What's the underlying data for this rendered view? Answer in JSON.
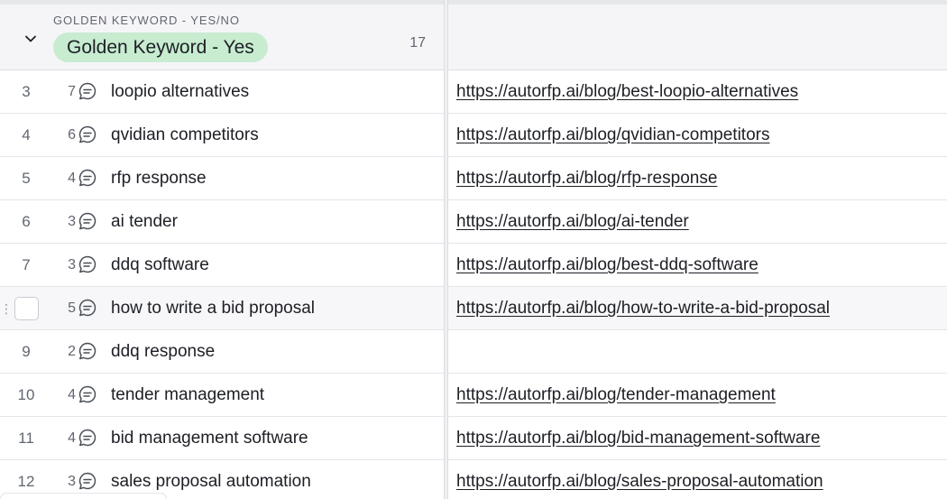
{
  "group": {
    "field_label": "GOLDEN KEYWORD - YES/NO",
    "value": "Golden Keyword - Yes",
    "count": "17",
    "pill_color": "#c7ecd0"
  },
  "rows": [
    {
      "num": "3",
      "comments": "7",
      "keyword": "loopio alternatives",
      "url": "https://autorfp.ai/blog/best-loopio-alternatives"
    },
    {
      "num": "4",
      "comments": "6",
      "keyword": "qvidian competitors",
      "url": "https://autorfp.ai/blog/qvidian-competitors"
    },
    {
      "num": "5",
      "comments": "4",
      "keyword": "rfp response",
      "url": "https://autorfp.ai/blog/rfp-response"
    },
    {
      "num": "6",
      "comments": "3",
      "keyword": "ai tender",
      "url": "https://autorfp.ai/blog/ai-tender"
    },
    {
      "num": "7",
      "comments": "3",
      "keyword": "ddq software",
      "url": "https://autorfp.ai/blog/best-ddq-software"
    },
    {
      "num": "",
      "comments": "5",
      "keyword": "how to write a bid proposal",
      "url": "https://autorfp.ai/blog/how-to-write-a-bid-proposal",
      "hover": true
    },
    {
      "num": "9",
      "comments": "2",
      "keyword": "ddq response",
      "url": ""
    },
    {
      "num": "10",
      "comments": "4",
      "keyword": "tender management",
      "url": "https://autorfp.ai/blog/tender-management"
    },
    {
      "num": "11",
      "comments": "4",
      "keyword": "bid management software",
      "url": "https://autorfp.ai/blog/bid-management-software"
    },
    {
      "num": "12",
      "comments": "3",
      "keyword": "sales proposal automation",
      "url": "https://autorfp.ai/blog/sales-proposal-automation"
    }
  ]
}
